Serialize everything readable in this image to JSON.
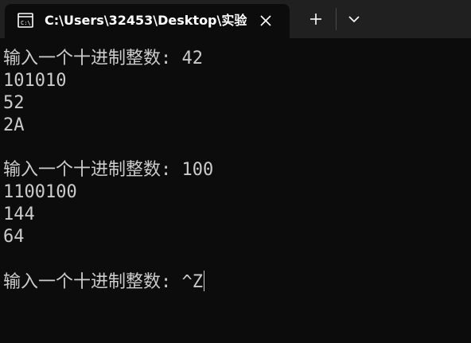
{
  "window": {
    "tab_title": "C:\\Users\\32453\\Desktop\\实验",
    "icons": {
      "tab": "terminal-icon",
      "close": "close-icon",
      "new_tab": "plus-icon",
      "dropdown": "chevron-down-icon"
    }
  },
  "terminal": {
    "lines": [
      "输入一个十进制整数: 42",
      "101010",
      "52",
      "2A",
      "",
      "输入一个十进制整数: 100",
      "1100100",
      "144",
      "64",
      "",
      "输入一个十进制整数: ^Z"
    ]
  },
  "colors": {
    "background": "#0c0c0c",
    "tabbar": "#202020",
    "text": "#cccccc"
  }
}
